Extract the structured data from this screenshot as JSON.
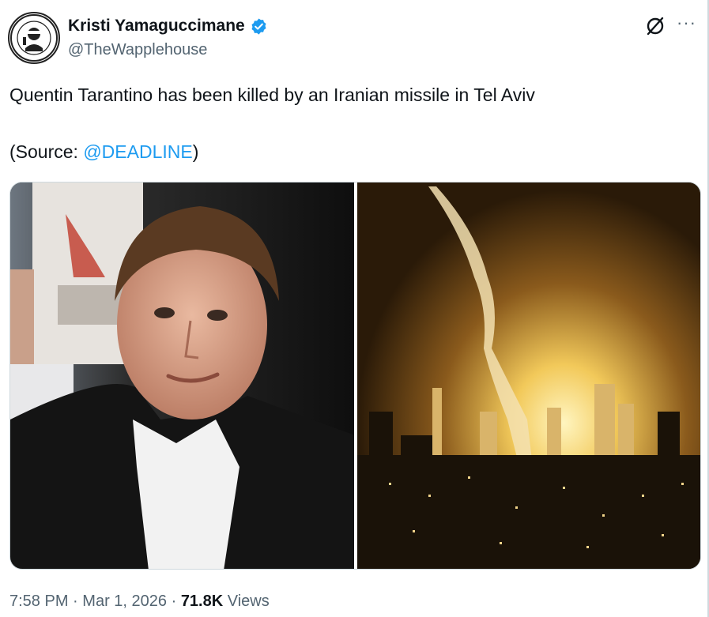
{
  "author": {
    "display_name": "Kristi Yamaguccimane",
    "handle": "@TheWapplehouse",
    "verified": true
  },
  "tweet": {
    "text_line1": "Quentin Tarantino has been killed by an Iranian missile in Tel Aviv",
    "source_prefix": "(Source: ",
    "source_mention": "@DEADLINE",
    "source_suffix": ")"
  },
  "media": [
    {
      "icon": "portrait-photo"
    },
    {
      "icon": "night-city-explosion-photo"
    }
  ],
  "meta": {
    "time": "7:58 PM",
    "separator": "·",
    "date": "Mar 1, 2026",
    "views_count": "71.8K",
    "views_label": "Views"
  },
  "colors": {
    "link": "#1d9bf0",
    "secondary_text": "#536471",
    "verified_badge": "#1d9bf0"
  }
}
